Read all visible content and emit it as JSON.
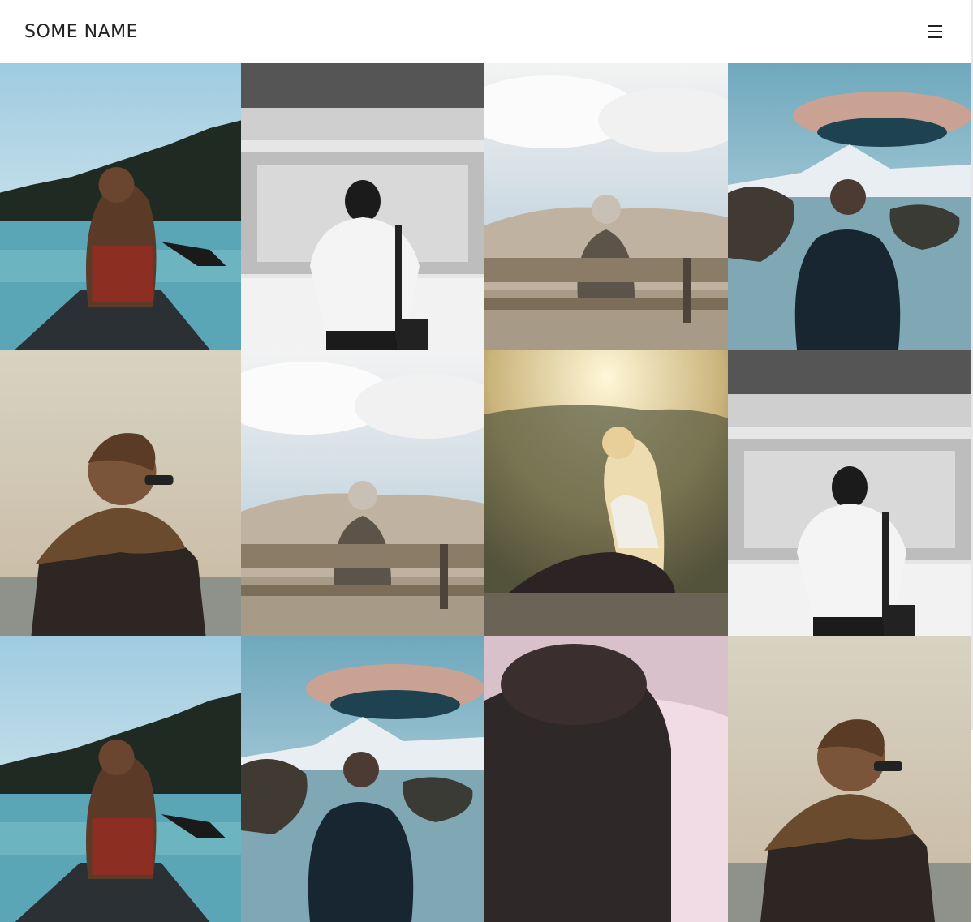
{
  "header": {
    "title": "SOME NAME",
    "menu_icon": "hamburger-menu-icon"
  },
  "gallery": {
    "items": [
      {
        "name": "photo-woman-in-canoe",
        "scene": "canoe"
      },
      {
        "name": "photo-woman-at-train",
        "scene": "train"
      },
      {
        "name": "photo-person-on-bench",
        "scene": "bench"
      },
      {
        "name": "photo-man-by-mountain-lake",
        "scene": "mountain"
      },
      {
        "name": "photo-person-with-scarf",
        "scene": "scarf"
      },
      {
        "name": "photo-person-on-bench",
        "scene": "bench"
      },
      {
        "name": "photo-woman-in-sunlight",
        "scene": "sunlight"
      },
      {
        "name": "photo-woman-at-train",
        "scene": "train"
      },
      {
        "name": "photo-woman-in-canoe",
        "scene": "canoe"
      },
      {
        "name": "photo-man-by-mountain-lake",
        "scene": "mountain"
      },
      {
        "name": "photo-woman-in-sunlight",
        "scene": "sunlight-close"
      },
      {
        "name": "photo-person-with-scarf",
        "scene": "scarf"
      }
    ]
  },
  "colors": {
    "header_bg": "#ffffff",
    "text": "#222222"
  }
}
